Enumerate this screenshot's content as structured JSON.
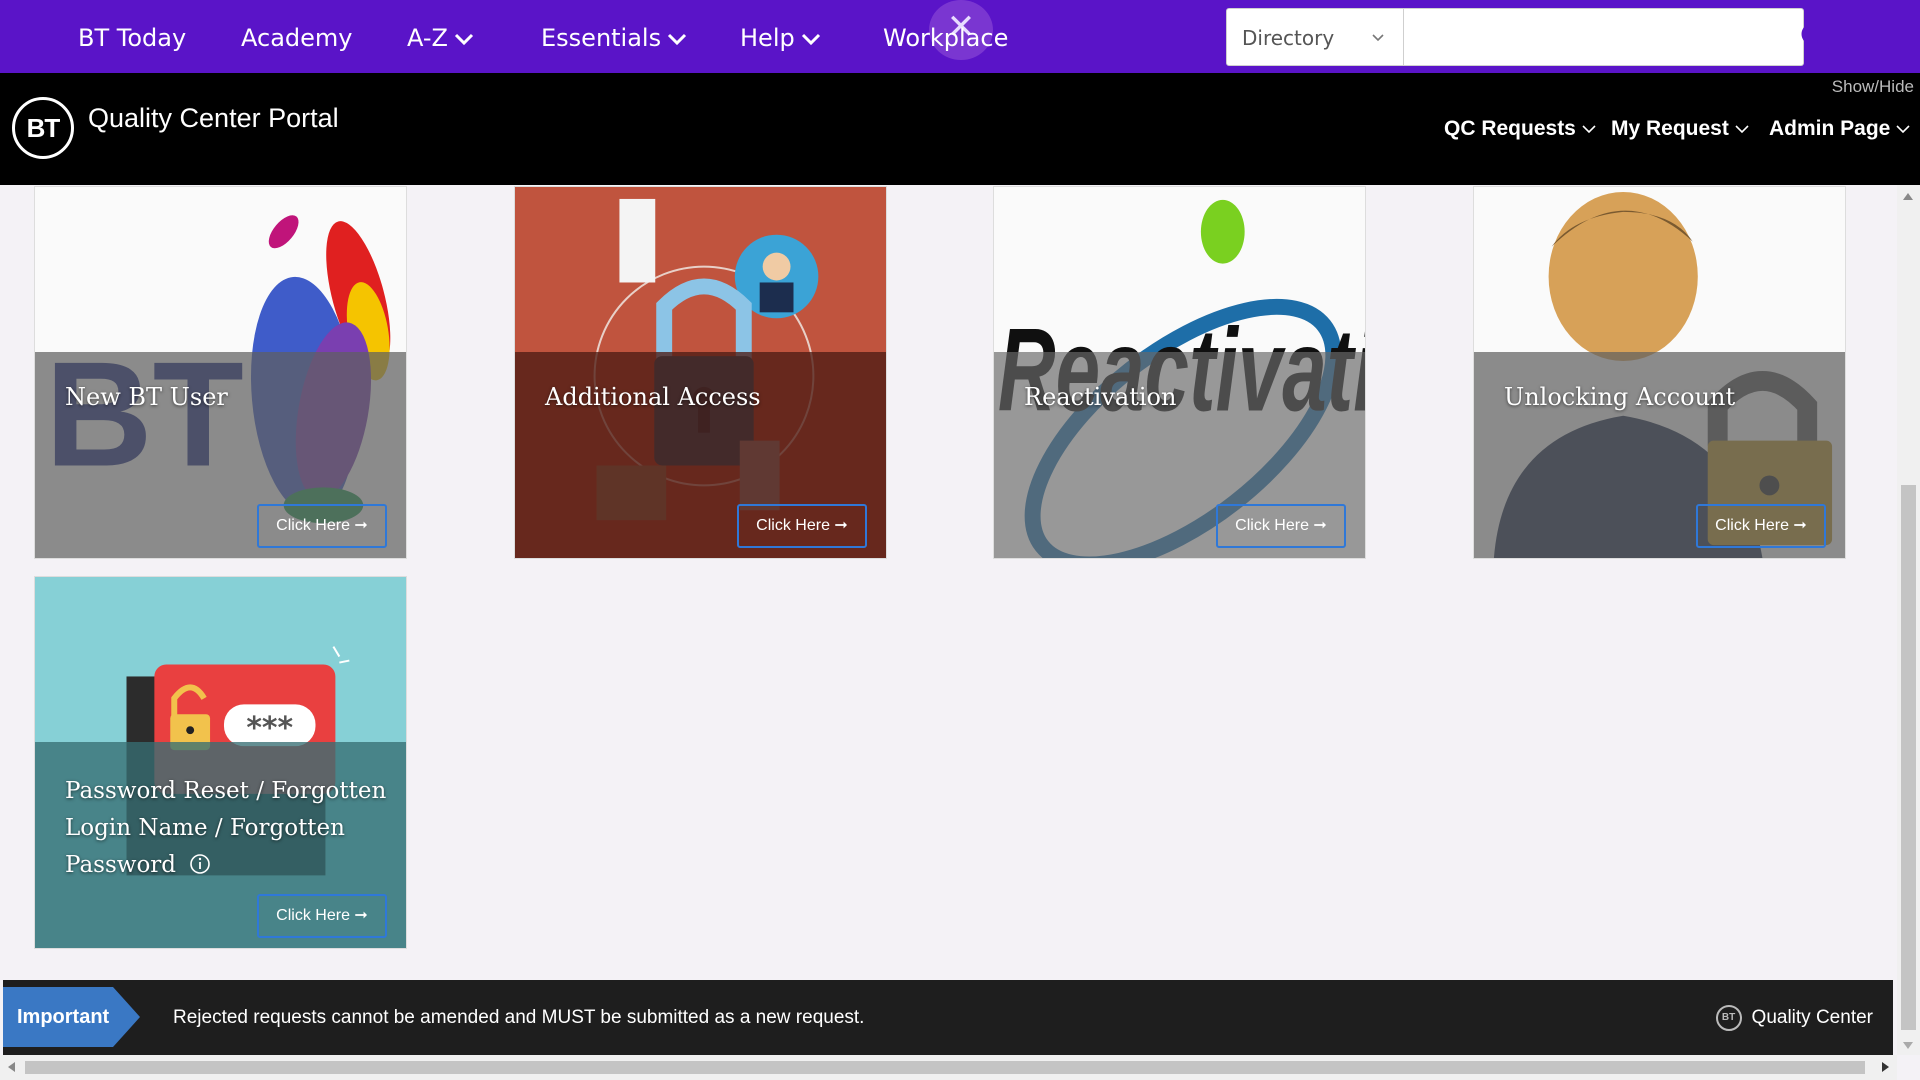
{
  "topnav": {
    "items": [
      {
        "label": "BT Today",
        "has_dropdown": false
      },
      {
        "label": "Academy",
        "has_dropdown": false
      },
      {
        "label": "A-Z",
        "has_dropdown": true
      },
      {
        "label": "Essentials",
        "has_dropdown": true
      },
      {
        "label": "Help",
        "has_dropdown": true
      },
      {
        "label": "Workplace",
        "has_dropdown": false
      }
    ],
    "close_icon": "close-icon",
    "search": {
      "scope_selected": "Directory",
      "placeholder": "",
      "value": "",
      "icon": "search-icon"
    },
    "colors": {
      "background": "#5a14c8",
      "text": "#ffffff"
    }
  },
  "header": {
    "logo_text": "BT",
    "title": "Quality Center Portal",
    "show_hide": "Show/Hide",
    "menu": [
      {
        "label": "QC Requests"
      },
      {
        "label": "My Request"
      },
      {
        "label": "Admin Page"
      }
    ]
  },
  "tiles": [
    {
      "title": "New BT User",
      "button": "Click Here ➞",
      "art_text": "BT"
    },
    {
      "title": "Additional Access",
      "button": "Click Here ➞"
    },
    {
      "title": "Reactivation",
      "button": "Click Here ➞",
      "art_text": "Reactivation"
    },
    {
      "title": "Unlocking Account",
      "button": "Click Here ➞"
    },
    {
      "title_lines": [
        "Password Reset / Forgotten",
        "Login Name / Forgotten",
        "Password"
      ],
      "button": "Click Here ➞",
      "info_icon": "info-icon",
      "art_text": "***"
    }
  ],
  "important": {
    "label": "Important",
    "message": "Rejected requests cannot be amended and MUST be submitted as a new request.",
    "badge_logo": "BT",
    "badge": "Quality Center",
    "colors": {
      "label_bg": "#3a78c4",
      "bar_bg": "#1e1e1e"
    }
  }
}
